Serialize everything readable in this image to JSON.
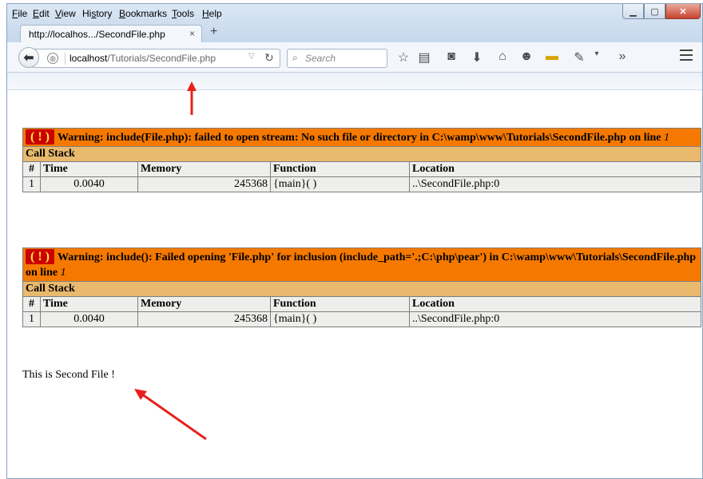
{
  "menu": [
    "File",
    "Edit",
    "View",
    "History",
    "Bookmarks",
    "Tools",
    "Help"
  ],
  "menu_underline": [
    "F",
    "E",
    "V",
    "s",
    "B",
    "T",
    "H"
  ],
  "tab": {
    "title": "http://localhos.../SecondFile.php",
    "close": "×",
    "new": "+"
  },
  "url": {
    "host": "localhost",
    "path": "/Tutorials/SecondFile.php"
  },
  "search": {
    "placeholder": "Search"
  },
  "errors": [
    {
      "bang": "( ! )",
      "message": "Warning: include(File.php): failed to open stream: No such file or directory in C:\\wamp\\www\\Tutorials\\SecondFile.php on line ",
      "line": "1",
      "callstack": "Call Stack",
      "columns": [
        "#",
        "Time",
        "Memory",
        "Function",
        "Location"
      ],
      "row": [
        "1",
        "0.0040",
        "245368",
        "{main}( )",
        "..\\SecondFile.php:0"
      ]
    },
    {
      "bang": "( ! )",
      "message": "Warning: include(): Failed opening 'File.php' for inclusion (include_path='.;C:\\php\\pear') in C:\\wamp\\www\\Tutorials\\SecondFile.php on line ",
      "line": "1",
      "callstack": "Call Stack",
      "columns": [
        "#",
        "Time",
        "Memory",
        "Function",
        "Location"
      ],
      "row": [
        "1",
        "0.0040",
        "245368",
        "{main}( )",
        "..\\SecondFile.php:0"
      ]
    }
  ],
  "body_text": "This is Second File !",
  "colors": {
    "error_bg": "#f57900",
    "callstack_bg": "#e9b96e",
    "cell_bg": "#eeeeec",
    "arrow": "#e8201c"
  }
}
